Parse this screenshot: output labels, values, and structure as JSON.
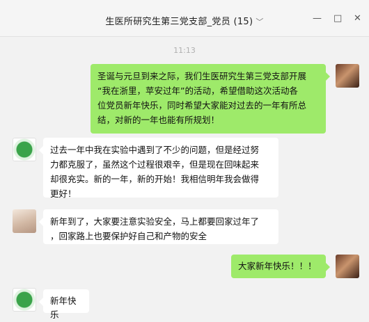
{
  "window": {
    "title": "生医所研究生第三党支部_党员 (15)",
    "controls": [
      "—",
      "□",
      "✕"
    ]
  },
  "chat": {
    "timestamp": "11:13",
    "messages": [
      {
        "sender": "me",
        "lines": [
          "圣诞与元旦到来之际，我们生医研究生第三党支部开展",
          "“我在浙里，苹安过年”的活动，希望借助这次活动各",
          "位党员新年快乐，同时希望大家能对过去的一年有所总",
          "结，对新的一年也能有所规划！"
        ]
      },
      {
        "sender": "green-avatar",
        "lines": [
          "过去一年中我在实验中遇到了不少的问题，但是经过努",
          "力都克服了，虽然这个过程很艰辛，但是现在回味起来",
          "却很充实。新的一年，新的开始！我相信明年我会做得",
          "更好！"
        ]
      },
      {
        "sender": "bunny-avatar",
        "lines": [
          "新年到了，大家要注意实验安全，马上都要回家过年了",
          "，回家路上也要保护好自己和产物的安全"
        ]
      },
      {
        "sender": "me",
        "lines": [
          "大家新年快乐！！！"
        ]
      },
      {
        "sender": "green-avatar",
        "lines": [
          "新年快乐"
        ]
      }
    ]
  },
  "colors": {
    "my_bubble": "#9eea6a",
    "their_bubble": "#ffffff",
    "background": "#f2f2f2"
  }
}
